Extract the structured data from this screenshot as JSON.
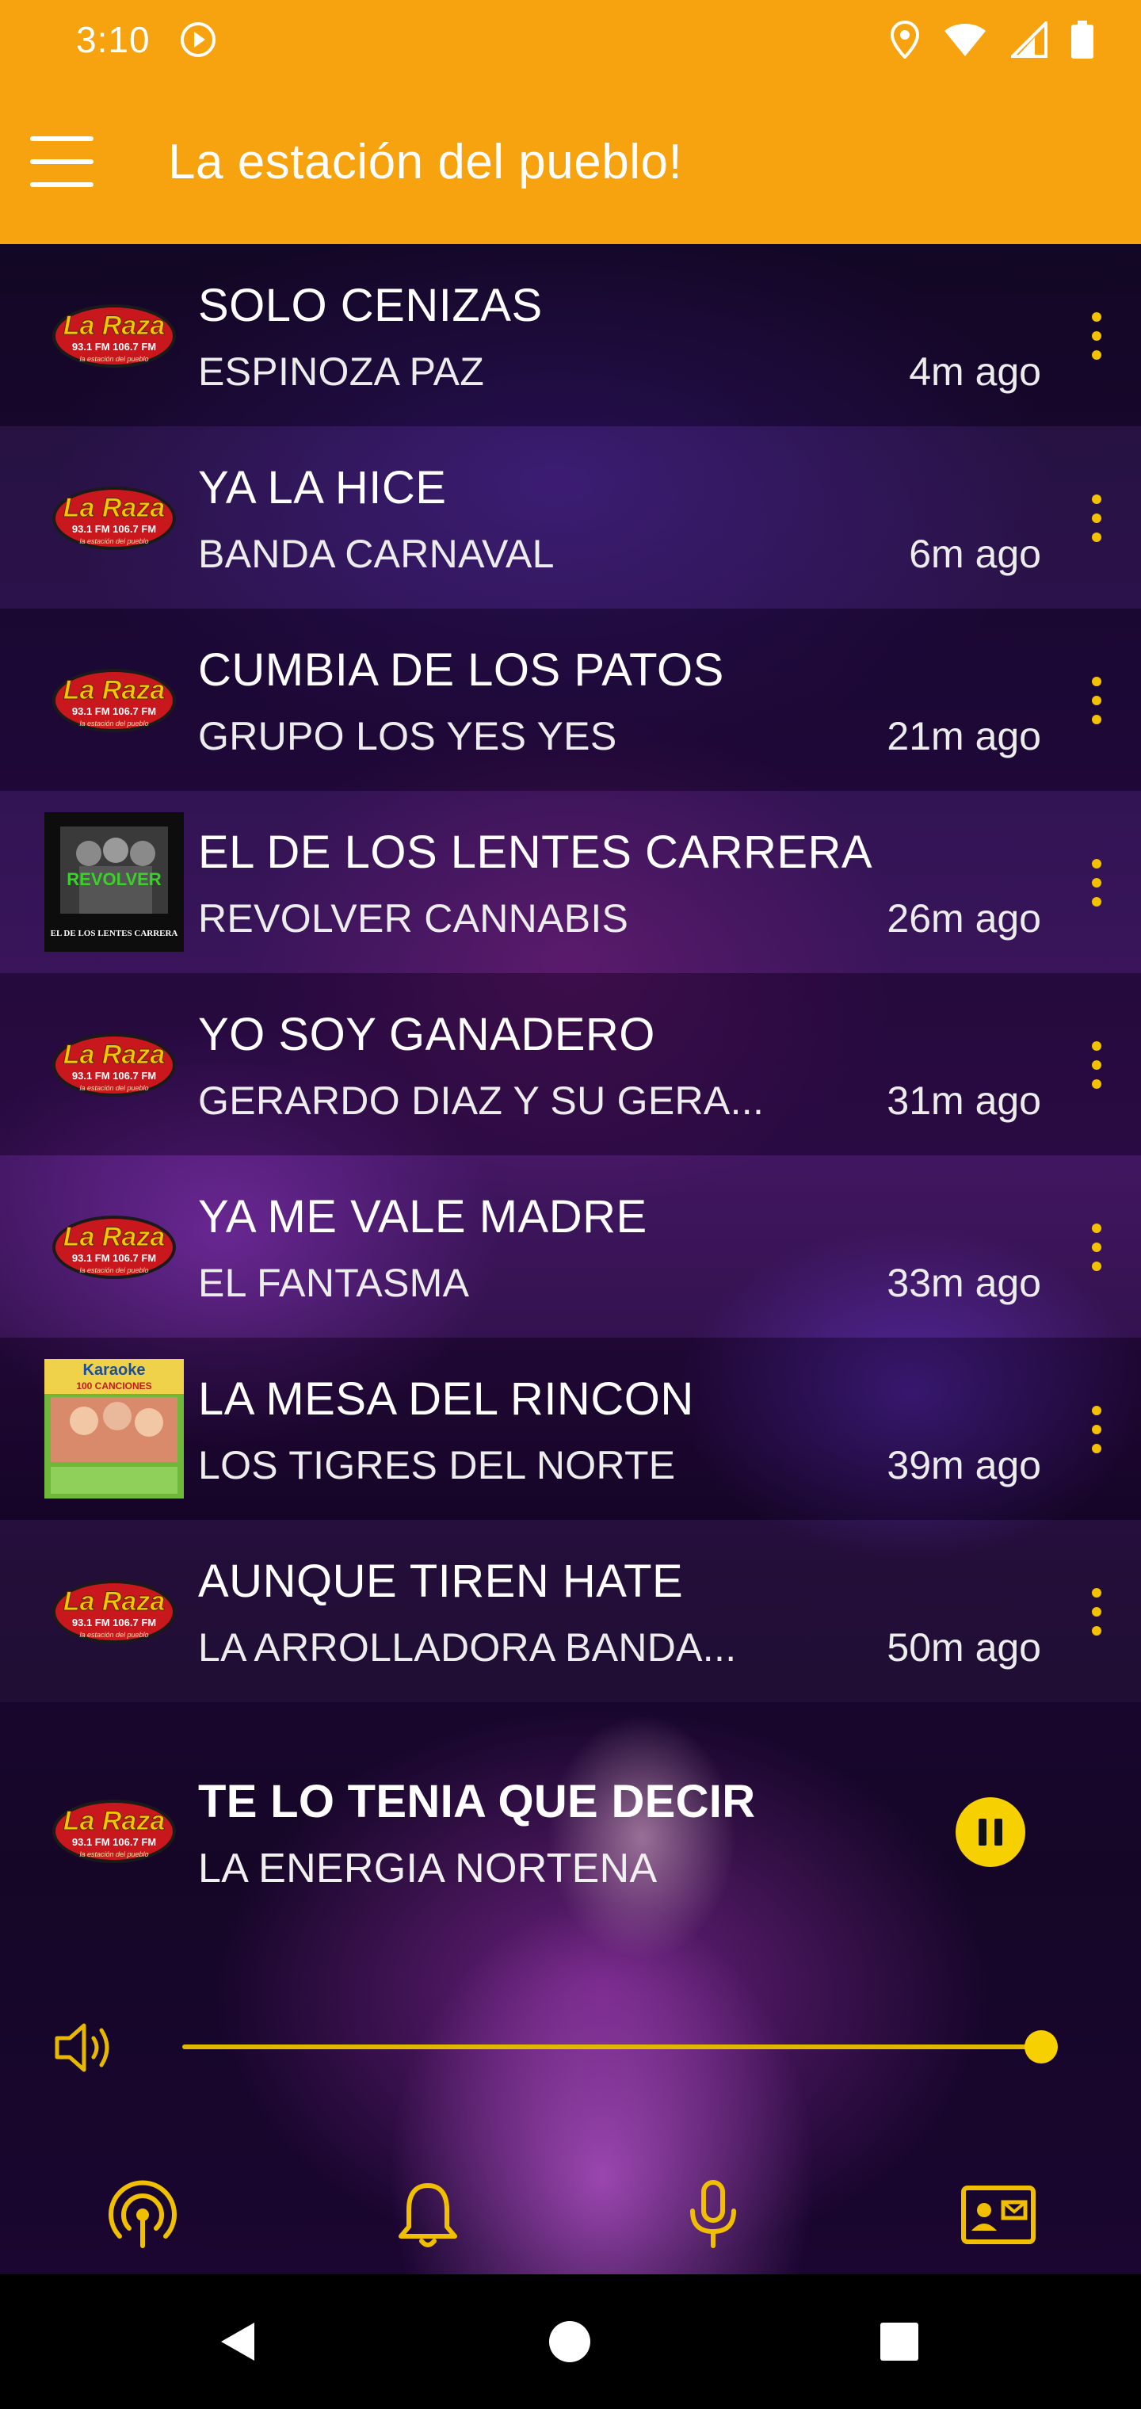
{
  "status_bar": {
    "time": "3:10",
    "icons": [
      "play-circle-icon",
      "location-icon",
      "wifi-icon",
      "signal-icon",
      "battery-icon"
    ]
  },
  "app_bar": {
    "menu_icon": "hamburger-menu-icon",
    "title": "La estación del pueblo!"
  },
  "colors": {
    "accent": "#f6a30f",
    "control": "#f6d000",
    "background": "#2a0c4d"
  },
  "tracks": [
    {
      "title": "SOLO CENIZAS",
      "artist": "ESPINOZA PAZ",
      "time": "4m ago",
      "art": "la-raza-logo"
    },
    {
      "title": "YA LA HICE",
      "artist": "BANDA CARNAVAL",
      "time": "6m ago",
      "art": "la-raza-logo"
    },
    {
      "title": "CUMBIA DE LOS PATOS",
      "artist": "GRUPO LOS YES YES",
      "time": "21m ago",
      "art": "la-raza-logo"
    },
    {
      "title": "EL DE LOS LENTES CARRERA",
      "artist": "REVOLVER CANNABIS",
      "time": "26m ago",
      "art": "album-cover-revolver"
    },
    {
      "title": "YO SOY GANADERO",
      "artist": "GERARDO DIAZ Y SU GERA...",
      "time": "31m ago",
      "art": "la-raza-logo"
    },
    {
      "title": "YA ME VALE MADRE",
      "artist": "EL FANTASMA",
      "time": "33m ago",
      "art": "la-raza-logo"
    },
    {
      "title": "LA MESA DEL RINCON",
      "artist": "LOS TIGRES DEL NORTE",
      "time": "39m ago",
      "art": "album-cover-karaoke"
    },
    {
      "title": "AUNQUE TIREN HATE",
      "artist": "LA ARROLLADORA BANDA...",
      "time": "50m ago",
      "art": "la-raza-logo"
    }
  ],
  "logo_text": {
    "line1": "La Raza",
    "line2": "93.1 FM 106.7 FM",
    "line3": "la estación del pueblo"
  },
  "album_karaoke": {
    "line1": "Karaoke",
    "line2": "100 CANCIONES"
  },
  "album_revolver": {
    "line1": "REVOLVER",
    "line2": "EL DE LOS LENTES CARRERA"
  },
  "now_playing": {
    "title": "TE LO TENIA QUE DECIR",
    "artist": "LA ENERGIA NORTENA",
    "state": "playing"
  },
  "volume": {
    "level": 1.0
  },
  "tabs": [
    {
      "icon": "broadcast-icon"
    },
    {
      "icon": "bell-icon"
    },
    {
      "icon": "microphone-icon"
    },
    {
      "icon": "contact-card-icon"
    }
  ],
  "nav": [
    "back-icon",
    "home-icon",
    "recents-icon"
  ]
}
